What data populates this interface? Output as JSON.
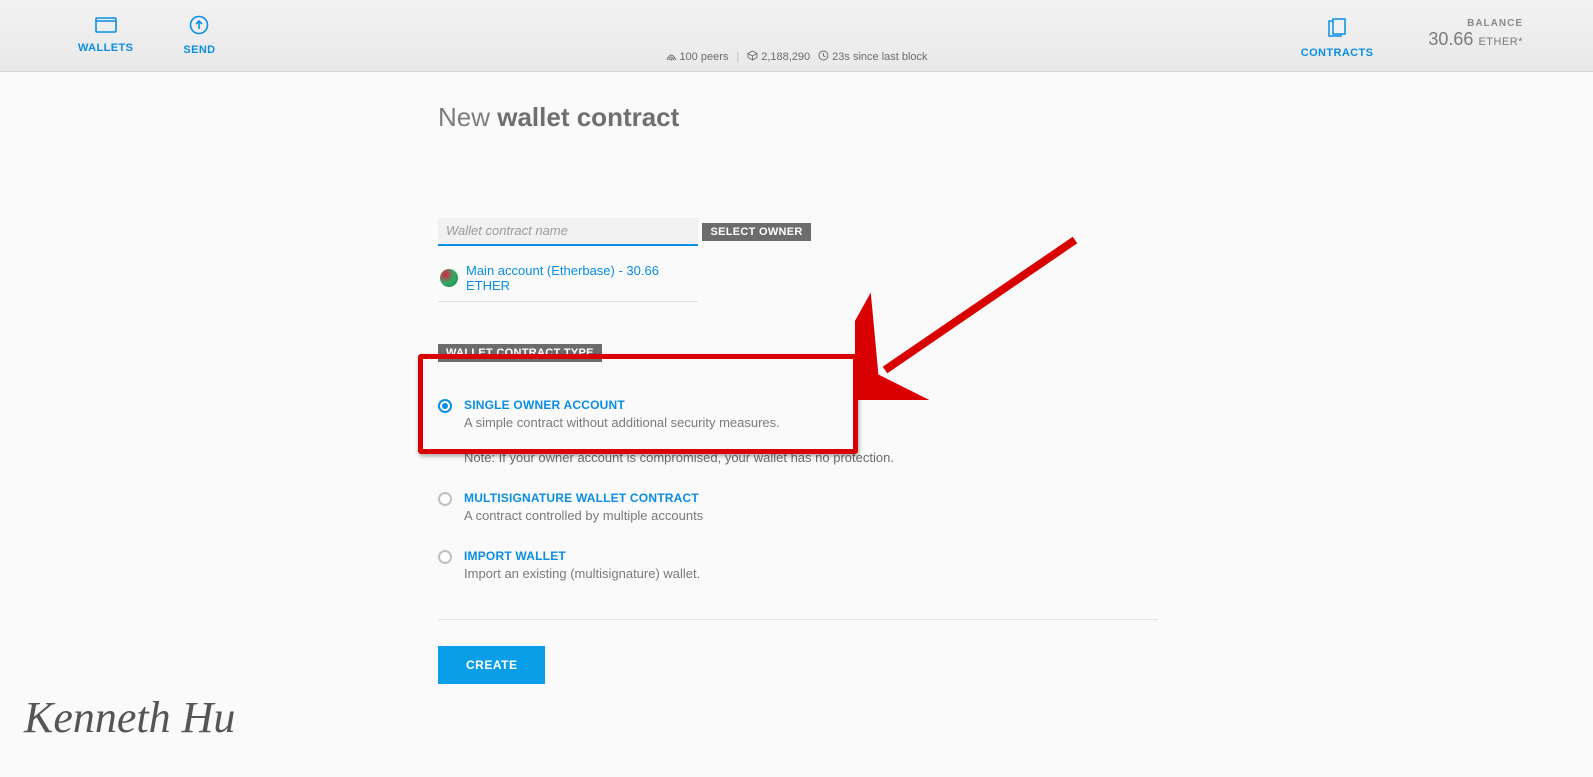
{
  "nav": {
    "wallets": "WALLETS",
    "send": "SEND",
    "contracts": "CONTRACTS"
  },
  "status": {
    "peers": "100 peers",
    "block": "2,188,290",
    "since": "23s since last block"
  },
  "balance": {
    "label": "BALANCE",
    "amount": "30.66",
    "unit": "ETHER*"
  },
  "page": {
    "title_prefix": "New ",
    "title_bold": "wallet contract",
    "name_placeholder": "Wallet contract name",
    "select_owner_label": "SELECT OWNER",
    "owner_text": "Main account (Etherbase) - 30.66 ETHER",
    "type_label": "WALLET CONTRACT TYPE",
    "create_label": "CREATE"
  },
  "types": [
    {
      "title": "SINGLE OWNER ACCOUNT",
      "desc": "A simple contract without additional security measures.",
      "note": "Note: If your owner account is compromised, your wallet has no protection.",
      "checked": true
    },
    {
      "title": "MULTISIGNATURE WALLET CONTRACT",
      "desc": "A contract controlled by multiple accounts",
      "note": "",
      "checked": false
    },
    {
      "title": "IMPORT WALLET",
      "desc": "Import an existing (multisignature) wallet.",
      "note": "",
      "checked": false
    }
  ],
  "watermark": "Kenneth Hu"
}
